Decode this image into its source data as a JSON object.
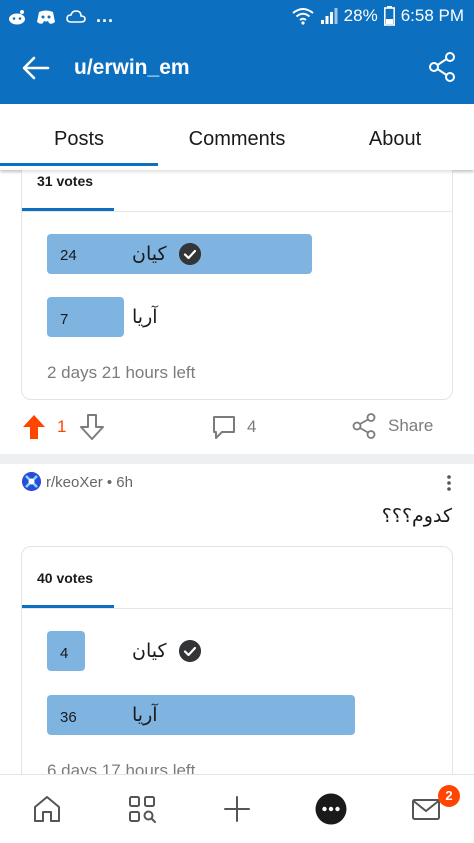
{
  "status_bar": {
    "dots": "...",
    "battery_pct": "28%",
    "time": "6:58 PM",
    "icons": [
      "reddit-icon",
      "discord-icon",
      "cloud-icon",
      "wifi-icon",
      "signal-icon",
      "battery-icon"
    ]
  },
  "header": {
    "title": "u/erwin_em",
    "icons": [
      "back-arrow-icon",
      "share-icon"
    ]
  },
  "tabs": [
    {
      "label": "Posts",
      "active": true
    },
    {
      "label": "Comments",
      "active": false
    },
    {
      "label": "About",
      "active": false
    }
  ],
  "poll1": {
    "votes_label": "31 votes",
    "options": [
      {
        "count": "24",
        "label": "کیان",
        "fraction": 0.774,
        "checked": true
      },
      {
        "count": "7",
        "label": "آریا",
        "fraction": 0.226,
        "checked": false
      }
    ],
    "time_left": "2 days 21 hours left"
  },
  "actions1": {
    "upvotes": "1",
    "comments": "4",
    "share_label": "Share"
  },
  "post2": {
    "subreddit": "r/keoXer",
    "age": "6h",
    "meta": "r/keoXer • 6h",
    "title": "کدوم؟؟؟"
  },
  "poll2": {
    "votes_label": "40 votes",
    "options": [
      {
        "count": "4",
        "label": "کیان",
        "fraction": 0.1,
        "checked": true
      },
      {
        "count": "36",
        "label": "آریا",
        "fraction": 0.9,
        "checked": false
      }
    ],
    "time_left": "6 days 17 hours left"
  },
  "bottom_nav": {
    "items": [
      "home-icon",
      "discover-icon",
      "create-post-icon",
      "chat-icon",
      "inbox-icon"
    ],
    "inbox_badge": "2"
  },
  "colors": {
    "brand_blue": "#0d6fbf",
    "poll_bar": "#7fb3e0",
    "upvote_orange": "#ff4500"
  }
}
